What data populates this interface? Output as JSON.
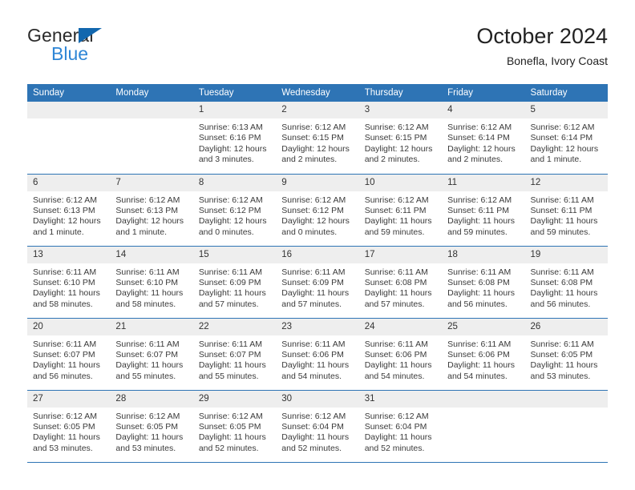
{
  "brand": {
    "line1": "General",
    "line2": "Blue",
    "triangle_color": "#1267ae",
    "blue_text_color": "#2e86d6"
  },
  "header": {
    "title": "October 2024",
    "subtitle": "Bonefla, Ivory Coast"
  },
  "theme": {
    "header_bg": "#2e74b5",
    "header_text": "#ffffff",
    "daynum_bg": "#eeeeee",
    "cell_bg": "#ffffff",
    "row_divider": "#2e74b5",
    "body_text": "#3a3a3a"
  },
  "calendar": {
    "weekday_headers": [
      "Sunday",
      "Monday",
      "Tuesday",
      "Wednesday",
      "Thursday",
      "Friday",
      "Saturday"
    ],
    "labels": {
      "sunrise_prefix": "Sunrise: ",
      "sunset_prefix": "Sunset: ",
      "daylight_prefix": "Daylight: "
    },
    "weeks": [
      [
        {
          "blank": true
        },
        {
          "blank": true
        },
        {
          "day": "1",
          "sunrise": "Sunrise: 6:13 AM",
          "sunset": "Sunset: 6:16 PM",
          "daylight_l1": "Daylight: 12 hours",
          "daylight_l2": "and 3 minutes."
        },
        {
          "day": "2",
          "sunrise": "Sunrise: 6:12 AM",
          "sunset": "Sunset: 6:15 PM",
          "daylight_l1": "Daylight: 12 hours",
          "daylight_l2": "and 2 minutes."
        },
        {
          "day": "3",
          "sunrise": "Sunrise: 6:12 AM",
          "sunset": "Sunset: 6:15 PM",
          "daylight_l1": "Daylight: 12 hours",
          "daylight_l2": "and 2 minutes."
        },
        {
          "day": "4",
          "sunrise": "Sunrise: 6:12 AM",
          "sunset": "Sunset: 6:14 PM",
          "daylight_l1": "Daylight: 12 hours",
          "daylight_l2": "and 2 minutes."
        },
        {
          "day": "5",
          "sunrise": "Sunrise: 6:12 AM",
          "sunset": "Sunset: 6:14 PM",
          "daylight_l1": "Daylight: 12 hours",
          "daylight_l2": "and 1 minute."
        }
      ],
      [
        {
          "day": "6",
          "sunrise": "Sunrise: 6:12 AM",
          "sunset": "Sunset: 6:13 PM",
          "daylight_l1": "Daylight: 12 hours",
          "daylight_l2": "and 1 minute."
        },
        {
          "day": "7",
          "sunrise": "Sunrise: 6:12 AM",
          "sunset": "Sunset: 6:13 PM",
          "daylight_l1": "Daylight: 12 hours",
          "daylight_l2": "and 1 minute."
        },
        {
          "day": "8",
          "sunrise": "Sunrise: 6:12 AM",
          "sunset": "Sunset: 6:12 PM",
          "daylight_l1": "Daylight: 12 hours",
          "daylight_l2": "and 0 minutes."
        },
        {
          "day": "9",
          "sunrise": "Sunrise: 6:12 AM",
          "sunset": "Sunset: 6:12 PM",
          "daylight_l1": "Daylight: 12 hours",
          "daylight_l2": "and 0 minutes."
        },
        {
          "day": "10",
          "sunrise": "Sunrise: 6:12 AM",
          "sunset": "Sunset: 6:11 PM",
          "daylight_l1": "Daylight: 11 hours",
          "daylight_l2": "and 59 minutes."
        },
        {
          "day": "11",
          "sunrise": "Sunrise: 6:12 AM",
          "sunset": "Sunset: 6:11 PM",
          "daylight_l1": "Daylight: 11 hours",
          "daylight_l2": "and 59 minutes."
        },
        {
          "day": "12",
          "sunrise": "Sunrise: 6:11 AM",
          "sunset": "Sunset: 6:11 PM",
          "daylight_l1": "Daylight: 11 hours",
          "daylight_l2": "and 59 minutes."
        }
      ],
      [
        {
          "day": "13",
          "sunrise": "Sunrise: 6:11 AM",
          "sunset": "Sunset: 6:10 PM",
          "daylight_l1": "Daylight: 11 hours",
          "daylight_l2": "and 58 minutes."
        },
        {
          "day": "14",
          "sunrise": "Sunrise: 6:11 AM",
          "sunset": "Sunset: 6:10 PM",
          "daylight_l1": "Daylight: 11 hours",
          "daylight_l2": "and 58 minutes."
        },
        {
          "day": "15",
          "sunrise": "Sunrise: 6:11 AM",
          "sunset": "Sunset: 6:09 PM",
          "daylight_l1": "Daylight: 11 hours",
          "daylight_l2": "and 57 minutes."
        },
        {
          "day": "16",
          "sunrise": "Sunrise: 6:11 AM",
          "sunset": "Sunset: 6:09 PM",
          "daylight_l1": "Daylight: 11 hours",
          "daylight_l2": "and 57 minutes."
        },
        {
          "day": "17",
          "sunrise": "Sunrise: 6:11 AM",
          "sunset": "Sunset: 6:08 PM",
          "daylight_l1": "Daylight: 11 hours",
          "daylight_l2": "and 57 minutes."
        },
        {
          "day": "18",
          "sunrise": "Sunrise: 6:11 AM",
          "sunset": "Sunset: 6:08 PM",
          "daylight_l1": "Daylight: 11 hours",
          "daylight_l2": "and 56 minutes."
        },
        {
          "day": "19",
          "sunrise": "Sunrise: 6:11 AM",
          "sunset": "Sunset: 6:08 PM",
          "daylight_l1": "Daylight: 11 hours",
          "daylight_l2": "and 56 minutes."
        }
      ],
      [
        {
          "day": "20",
          "sunrise": "Sunrise: 6:11 AM",
          "sunset": "Sunset: 6:07 PM",
          "daylight_l1": "Daylight: 11 hours",
          "daylight_l2": "and 56 minutes."
        },
        {
          "day": "21",
          "sunrise": "Sunrise: 6:11 AM",
          "sunset": "Sunset: 6:07 PM",
          "daylight_l1": "Daylight: 11 hours",
          "daylight_l2": "and 55 minutes."
        },
        {
          "day": "22",
          "sunrise": "Sunrise: 6:11 AM",
          "sunset": "Sunset: 6:07 PM",
          "daylight_l1": "Daylight: 11 hours",
          "daylight_l2": "and 55 minutes."
        },
        {
          "day": "23",
          "sunrise": "Sunrise: 6:11 AM",
          "sunset": "Sunset: 6:06 PM",
          "daylight_l1": "Daylight: 11 hours",
          "daylight_l2": "and 54 minutes."
        },
        {
          "day": "24",
          "sunrise": "Sunrise: 6:11 AM",
          "sunset": "Sunset: 6:06 PM",
          "daylight_l1": "Daylight: 11 hours",
          "daylight_l2": "and 54 minutes."
        },
        {
          "day": "25",
          "sunrise": "Sunrise: 6:11 AM",
          "sunset": "Sunset: 6:06 PM",
          "daylight_l1": "Daylight: 11 hours",
          "daylight_l2": "and 54 minutes."
        },
        {
          "day": "26",
          "sunrise": "Sunrise: 6:11 AM",
          "sunset": "Sunset: 6:05 PM",
          "daylight_l1": "Daylight: 11 hours",
          "daylight_l2": "and 53 minutes."
        }
      ],
      [
        {
          "day": "27",
          "sunrise": "Sunrise: 6:12 AM",
          "sunset": "Sunset: 6:05 PM",
          "daylight_l1": "Daylight: 11 hours",
          "daylight_l2": "and 53 minutes."
        },
        {
          "day": "28",
          "sunrise": "Sunrise: 6:12 AM",
          "sunset": "Sunset: 6:05 PM",
          "daylight_l1": "Daylight: 11 hours",
          "daylight_l2": "and 53 minutes."
        },
        {
          "day": "29",
          "sunrise": "Sunrise: 6:12 AM",
          "sunset": "Sunset: 6:05 PM",
          "daylight_l1": "Daylight: 11 hours",
          "daylight_l2": "and 52 minutes."
        },
        {
          "day": "30",
          "sunrise": "Sunrise: 6:12 AM",
          "sunset": "Sunset: 6:04 PM",
          "daylight_l1": "Daylight: 11 hours",
          "daylight_l2": "and 52 minutes."
        },
        {
          "day": "31",
          "sunrise": "Sunrise: 6:12 AM",
          "sunset": "Sunset: 6:04 PM",
          "daylight_l1": "Daylight: 11 hours",
          "daylight_l2": "and 52 minutes."
        },
        {
          "blank": true
        },
        {
          "blank": true
        }
      ]
    ]
  }
}
